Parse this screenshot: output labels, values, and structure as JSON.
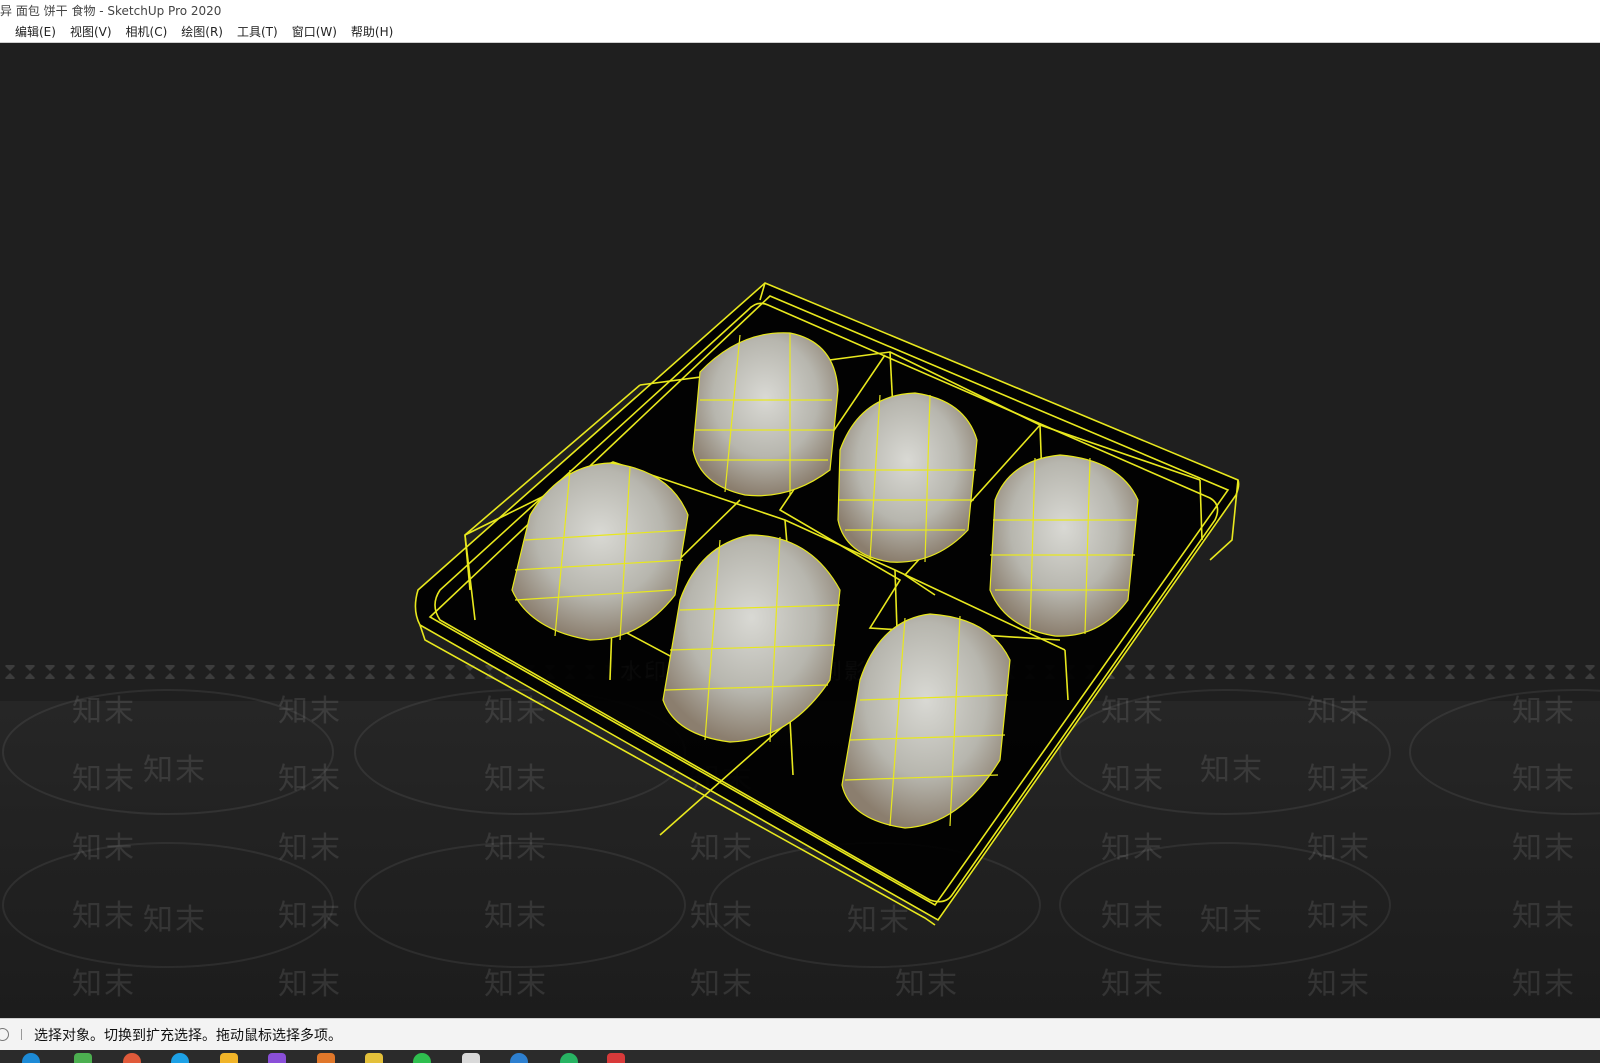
{
  "window": {
    "title": "异 面包 饼干 食物 - SketchUp Pro 2020"
  },
  "menu": {
    "items": [
      {
        "label": "编辑(E)"
      },
      {
        "label": "视图(V)"
      },
      {
        "label": "相机(C)"
      },
      {
        "label": "绘图(R)"
      },
      {
        "label": "工具(T)"
      },
      {
        "label": "窗口(W)"
      },
      {
        "label": "帮助(H)"
      }
    ]
  },
  "watermark": {
    "brand": "知末",
    "center_left": "水印",
    "center_right": "到影"
  },
  "status": {
    "message": "选择对象。切换到扩充选择。拖动鼠标选择多项。"
  },
  "colors": {
    "selection": "#e8e81e",
    "viewport_bg": "#1f1f1f"
  },
  "taskbar": {
    "icons": [
      "edge-icon",
      "store-icon",
      "chrome-icon",
      "browser-icon",
      "folder-icon",
      "app-icon",
      "office-icon",
      "note-icon",
      "wechat-icon",
      "qq-icon",
      "app2-icon",
      "app3-icon",
      "acrobat-icon"
    ]
  }
}
